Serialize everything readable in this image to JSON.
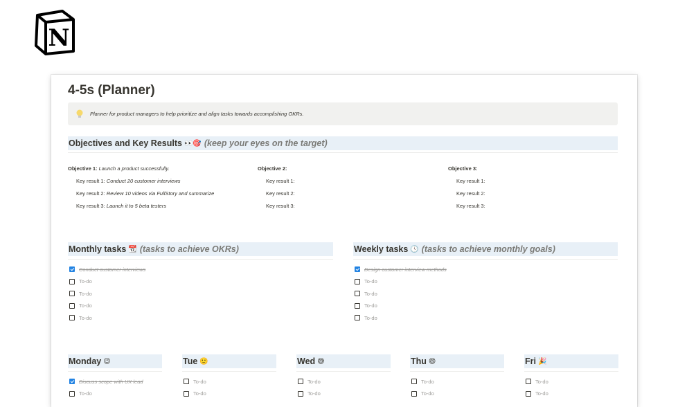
{
  "brand": {
    "logo_letter": "N",
    "logo_name": "notion-logo"
  },
  "page": {
    "title": "4-5s (Planner)",
    "callout_text": "Planner for product managers to help prioritize and align tasks towards accomplishing OKRs."
  },
  "okr": {
    "heading": "Objectives and Key Results",
    "heading_emoji": "👀🎯",
    "heading_sub": "(keep your eyes on the target)",
    "columns": [
      {
        "objective_label": "Objective 1:",
        "objective_value": "Launch a product successfully.",
        "key_results": [
          {
            "label": "Key result 1:",
            "value": "Conduct 20 customer interviews"
          },
          {
            "label": "Key result 2:",
            "value": "Review 10 videos via FullStory and summarize"
          },
          {
            "label": "Key result 3:",
            "value": "Launch it to 5 beta testers"
          }
        ]
      },
      {
        "objective_label": "Objective 2:",
        "objective_value": "",
        "key_results": [
          {
            "label": "Key result 1:",
            "value": ""
          },
          {
            "label": "Key result 2:",
            "value": ""
          },
          {
            "label": "Key result 3:",
            "value": ""
          }
        ]
      },
      {
        "objective_label": "Objective 3:",
        "objective_value": "",
        "key_results": [
          {
            "label": "Key result 1:",
            "value": ""
          },
          {
            "label": "Key result 2:",
            "value": ""
          },
          {
            "label": "Key result 3:",
            "value": ""
          }
        ]
      }
    ]
  },
  "monthly": {
    "heading": "Monthly tasks",
    "heading_emoji": "📆",
    "heading_sub": "(tasks to achieve OKRs)",
    "todos": [
      {
        "text": "Conduct customer interviews",
        "checked": true
      },
      {
        "text": "To-do",
        "checked": false
      },
      {
        "text": "To-do",
        "checked": false
      },
      {
        "text": "To-do",
        "checked": false
      },
      {
        "text": "To-do",
        "checked": false
      }
    ]
  },
  "weekly": {
    "heading": "Weekly tasks",
    "heading_emoji": "🕓",
    "heading_sub": "(tasks to achieve monthly goals)",
    "todos": [
      {
        "text": "Design customer interview methods",
        "checked": true
      },
      {
        "text": "To-do",
        "checked": false
      },
      {
        "text": "To-do",
        "checked": false
      },
      {
        "text": "To-do",
        "checked": false
      },
      {
        "text": "To-do",
        "checked": false
      }
    ]
  },
  "days": [
    {
      "label": "Monday",
      "emoji": "😉",
      "todos": [
        {
          "text": "Discuss scope with UX lead",
          "checked": true
        },
        {
          "text": "To-do",
          "checked": false
        }
      ]
    },
    {
      "label": "Tue",
      "emoji": "🙂",
      "todos": [
        {
          "text": "To-do",
          "checked": false
        },
        {
          "text": "To-do",
          "checked": false
        }
      ]
    },
    {
      "label": "Wed",
      "emoji": "😅",
      "todos": [
        {
          "text": "To-do",
          "checked": false
        },
        {
          "text": "To-do",
          "checked": false
        }
      ]
    },
    {
      "label": "Thu",
      "emoji": "😄",
      "todos": [
        {
          "text": "To-do",
          "checked": false
        },
        {
          "text": "To-do",
          "checked": false
        }
      ]
    },
    {
      "label": "Fri",
      "emoji": "🎉",
      "todos": [
        {
          "text": "To-do",
          "checked": false
        },
        {
          "text": "To-do",
          "checked": false
        }
      ]
    }
  ],
  "colors": {
    "heading_bg": "#e8f0f7",
    "checkbox_checked": "#2383e2",
    "callout_bg": "#f1f1ef",
    "text": "#37352f",
    "muted": "#9b9a97"
  }
}
